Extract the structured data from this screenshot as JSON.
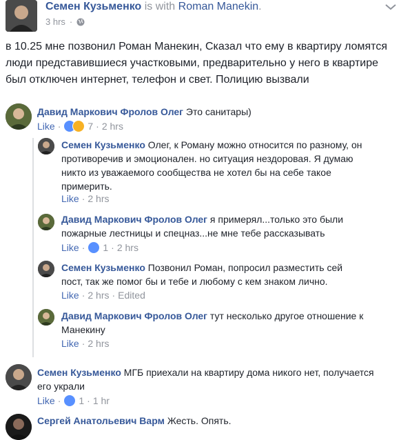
{
  "post": {
    "author": "Семен Кузьменко",
    "with_text": "is with",
    "tagged": "Roman Manekin",
    "period": ".",
    "time": "3 hrs",
    "dot": "·",
    "body": "в 10.25 мне позвонил Роман Манекин, Сказал что ему в квартиру ломятся люди представившиеся участковыми, предварительно у него в квартире был отключен интернет, телефон и свет. Полицию вызвали"
  },
  "comments": [
    {
      "author": "Давид Маркович Фролов Олег",
      "text": "Это санитары)",
      "like": "Like",
      "reactions": "7",
      "time": "2 hrs"
    },
    {
      "author": "Семен Кузьменко",
      "text": "Олег, к Роману можно относится по разному, он противоречив и эмоционален. но ситуация нездоровая. Я думаю никто из уважаемого сообщества не хотел бы на себе такое примерить.",
      "like": "Like",
      "time": "2 hrs"
    },
    {
      "author": "Давид Маркович Фролов Олег",
      "text": "я примерял...только это были пожарные лестницы и спецназ...не мне тебе рассказывать",
      "like": "Like",
      "reactions": "1",
      "time": "2 hrs"
    },
    {
      "author": "Семен Кузьменко",
      "text": "Позвонил Роман, попросил разместить сей пост, так же помог бы и тебе и любому с кем знаком лично.",
      "like": "Like",
      "time": "2 hrs",
      "edited": "Edited"
    },
    {
      "author": "Давид Маркович Фролов Олег",
      "text": "тут несколько другое отношение к Манекину",
      "like": "Like",
      "time": "2 hrs"
    },
    {
      "author": "Семен Кузьменко",
      "text": "МГБ приехали на квартиру дома никого нет, получается его украли",
      "like": "Like",
      "reactions": "1",
      "time": "1 hr"
    },
    {
      "author": "Сергей Анатольевич Варм",
      "text": "Жесть. Опять."
    }
  ],
  "colors": {
    "link_blue": "#365899",
    "like_blue": "#4267b2",
    "meta_gray": "#90949c",
    "text": "#1d2129",
    "like_reaction": "#5890ff",
    "haha_reaction": "#f7b125"
  },
  "icons": [
    "globe-icon",
    "more-options-icon",
    "like-reaction-icon",
    "haha-reaction-icon"
  ]
}
